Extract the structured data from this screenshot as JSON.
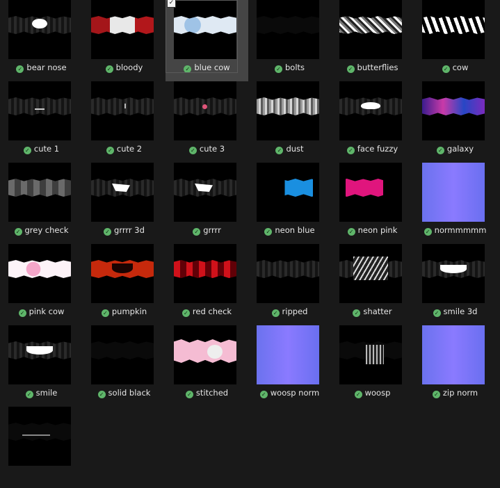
{
  "selected_check": "✓",
  "status_glyph": "✓",
  "tiles": [
    {
      "label": "bear nose",
      "variant": "dark",
      "mark": "bear-nose"
    },
    {
      "label": "bloody",
      "variant": "bloody"
    },
    {
      "label": "blue cow",
      "variant": "bluecow",
      "selected": true
    },
    {
      "label": "bolts",
      "variant": "black"
    },
    {
      "label": "butterflies",
      "variant": "butterflies"
    },
    {
      "label": "cow",
      "variant": "cow"
    },
    {
      "label": "cute 1",
      "variant": "dark",
      "mark": "cute1"
    },
    {
      "label": "cute 2",
      "variant": "dark",
      "mark": "cute2"
    },
    {
      "label": "cute 3",
      "variant": "dark",
      "mark": "cute3"
    },
    {
      "label": "dust",
      "variant": "dust"
    },
    {
      "label": "face fuzzy",
      "variant": "dark",
      "mark": "mustache"
    },
    {
      "label": "galaxy",
      "variant": "galaxy"
    },
    {
      "label": "grey check",
      "variant": "grey"
    },
    {
      "label": "grrrr 3d",
      "variant": "dark",
      "mark": "grin-left"
    },
    {
      "label": "grrrr",
      "variant": "dark",
      "mark": "grin-left"
    },
    {
      "label": "neon blue",
      "variant": "neonblue"
    },
    {
      "label": "neon pink",
      "variant": "neonpink"
    },
    {
      "label": "normmmmm",
      "variant": "norm"
    },
    {
      "label": "pink cow",
      "variant": "pinkcow"
    },
    {
      "label": "pumpkin",
      "variant": "pumpkin",
      "mark": "pumpkin-mouth"
    },
    {
      "label": "red check",
      "variant": "redcheck"
    },
    {
      "label": "ripped",
      "variant": "dark"
    },
    {
      "label": "shatter",
      "variant": "dark",
      "mark": "shatter"
    },
    {
      "label": "smile 3d",
      "variant": "dark",
      "mark": "smile"
    },
    {
      "label": "smile",
      "variant": "dark",
      "mark": "smile"
    },
    {
      "label": "solid black",
      "variant": "black"
    },
    {
      "label": "stitched",
      "variant": "stitched",
      "mark": "stitch"
    },
    {
      "label": "woosp norm",
      "variant": "norm"
    },
    {
      "label": "woosp",
      "variant": "black",
      "mark": "woosp"
    },
    {
      "label": "zip norm",
      "variant": "norm"
    },
    {
      "label": "",
      "variant": "black",
      "mark": "line",
      "partial": true
    }
  ]
}
